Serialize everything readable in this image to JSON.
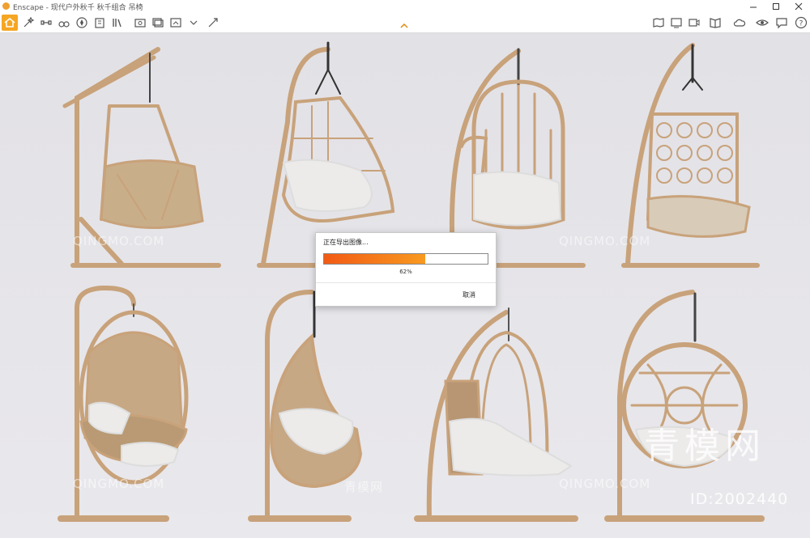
{
  "window": {
    "title": "Enscape - 现代户外秋千 秋千组合 吊椅"
  },
  "toolbar": {
    "left_icons": [
      "home-icon",
      "wand-icon",
      "link-icon",
      "compass-icon",
      "walk-icon",
      "binoculars-icon",
      "measure-icon",
      "settings-icon",
      "building-icon",
      "library-icon",
      "material-editor-icon",
      "screenshot-icon",
      "batch-render-icon",
      "export-icon"
    ],
    "right_icons": [
      "panorama-icon",
      "web-standalone-icon",
      "video-icon",
      "book-icon",
      "scene-icon",
      "cloud-icon",
      "visibility-icon",
      "feedback-icon",
      "help-icon"
    ],
    "colors": {
      "home_active": "#f5a623"
    }
  },
  "dialog": {
    "title": "正在导出图像...",
    "progress": 0.62,
    "percent_text": "62%",
    "cancel_label": "取消",
    "colors": {
      "bar_start": "#f25a15",
      "bar_end": "#f89a20"
    }
  },
  "watermarks": {
    "site_latin": "QINGMO.COM",
    "site_cn": "青模网",
    "brand_big": "青模网",
    "id_text": "ID:2002440"
  },
  "scene": {
    "background": "#e4e3e8",
    "rattan": "#c8a27a"
  }
}
